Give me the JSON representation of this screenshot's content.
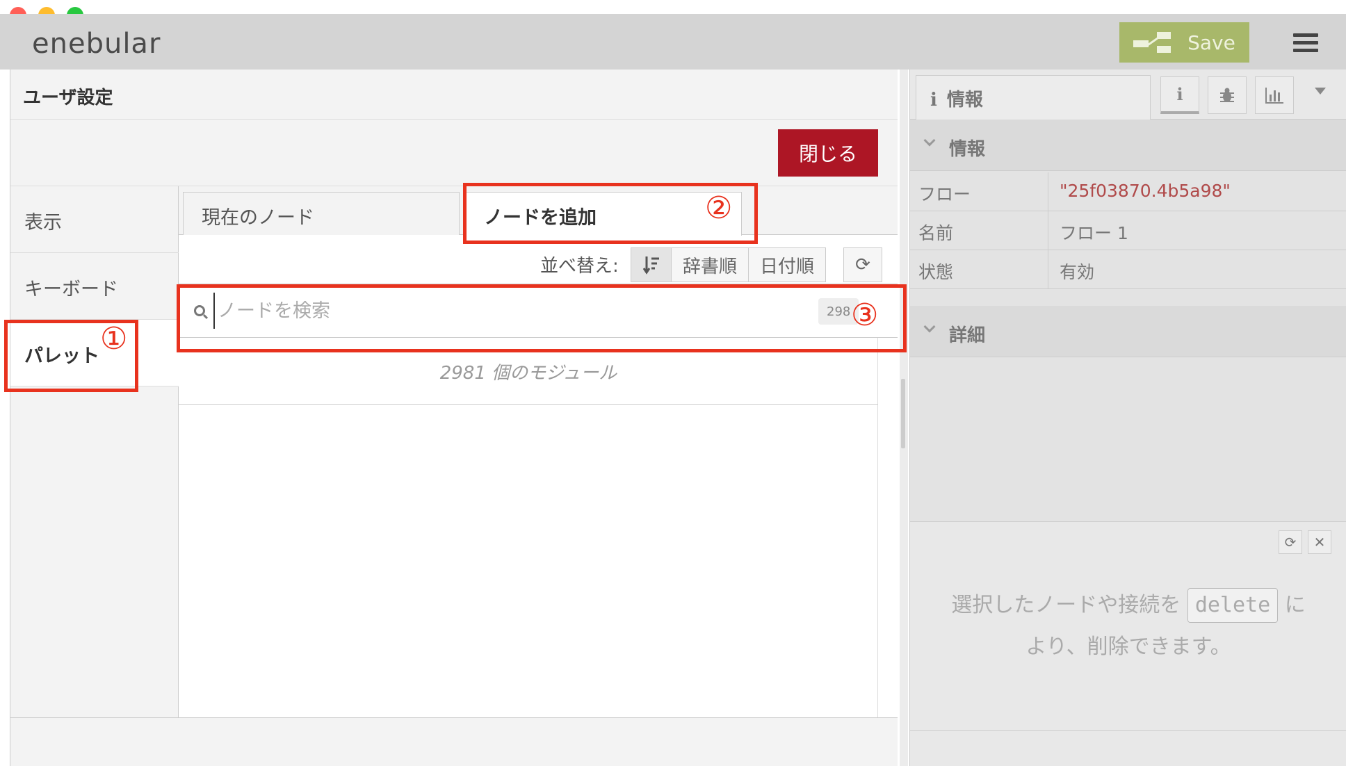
{
  "app": {
    "logo": "enebular",
    "save_label": "Save"
  },
  "dialog": {
    "title": "ユーザ設定",
    "close_label": "閉じる",
    "menu": [
      {
        "label": "表示"
      },
      {
        "label": "キーボード"
      },
      {
        "label": "パレット"
      }
    ],
    "tabs": [
      {
        "label": "現在のノード"
      },
      {
        "label": "ノードを追加"
      }
    ],
    "sort": {
      "label": "並べ替え:",
      "options": [
        "辞書順",
        "日付順"
      ]
    },
    "search": {
      "placeholder": "ノードを検索",
      "count": "298"
    },
    "module_count": "2981 個のモジュール"
  },
  "sidebar": {
    "tab_label": "情報",
    "info_section": "情報",
    "detail_section": "詳細",
    "rows": [
      {
        "key": "フロー",
        "value": "\"25f03870.4b5a98\""
      },
      {
        "key": "名前",
        "value": "フロー 1"
      },
      {
        "key": "状態",
        "value": "有効"
      }
    ],
    "hint_before": "選択したノードや接続を",
    "hint_key": "delete",
    "hint_after": "に",
    "hint_line2": "より、削除できます。"
  },
  "annotations": [
    "①",
    "②",
    "③"
  ],
  "colors": {
    "annotation": "#e8321e",
    "close_button": "#ad1625",
    "save_button": "#a8b86a",
    "flow_id": "#b04a4a"
  }
}
